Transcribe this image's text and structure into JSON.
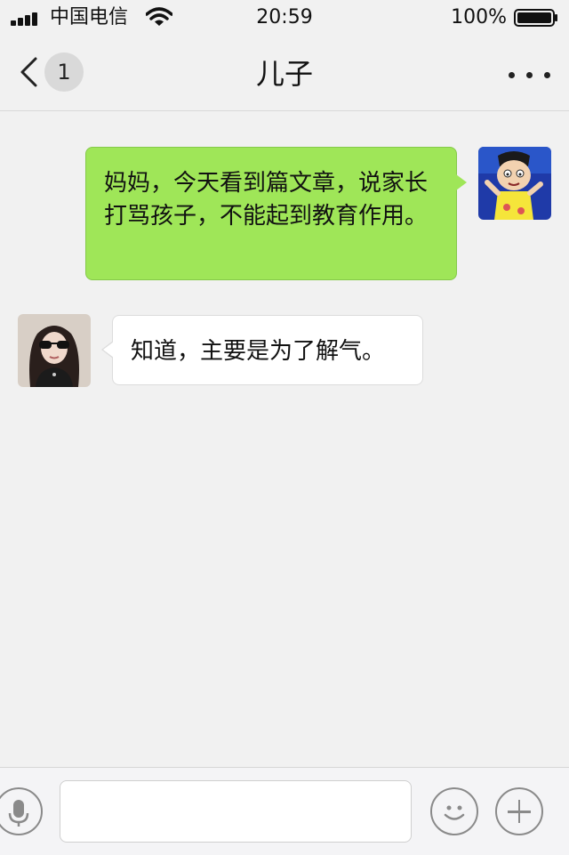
{
  "status_bar": {
    "carrier": "中国电信",
    "time": "20:59",
    "battery_percent": "100%",
    "battery_level": 1.0
  },
  "nav": {
    "unread_count": "1",
    "title": "儿子",
    "more_icon": "more-dots-icon"
  },
  "messages": [
    {
      "direction": "outgoing",
      "text": "妈妈，今天看到篇文章，说家长打骂孩子，不能起到教育作用。"
    },
    {
      "direction": "incoming",
      "text": "知道，主要是为了解气。"
    }
  ],
  "input_bar": {
    "text_value": "",
    "voice_icon": "microphone-icon",
    "emoji_icon": "smiley-icon",
    "add_icon": "plus-icon"
  },
  "colors": {
    "background": "#f1f1f1",
    "outgoing_bubble": "#9fe658",
    "incoming_bubble": "#ffffff"
  }
}
